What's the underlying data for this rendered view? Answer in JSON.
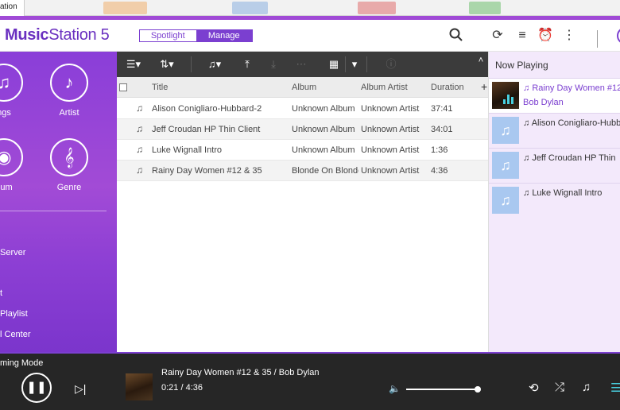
{
  "browser": {
    "tab_fragment": "ation"
  },
  "header": {
    "brand_bold": "Music",
    "brand_rest": "Station 5",
    "mode_spotlight": "Spotlight",
    "mode_manage": "Manage",
    "icons": [
      "search-icon",
      "refresh-icon",
      "sort-icon",
      "alarm-icon",
      "more-vertical-icon"
    ]
  },
  "sidebar": {
    "tiles": [
      {
        "label": "ngs",
        "icon": "music-note-icon",
        "glyph": "♫"
      },
      {
        "label": "Artist",
        "icon": "artist-icon",
        "glyph": "♪"
      },
      {
        "label": "bum",
        "icon": "album-disc-icon",
        "glyph": "◉"
      },
      {
        "label": "Genre",
        "icon": "guitar-icon",
        "glyph": "𝄞"
      }
    ],
    "items": [
      " Server",
      "t",
      " Playlist",
      "l Center"
    ]
  },
  "toolbar": {
    "icons": [
      "list-view-icon",
      "sort-order-icon",
      "add-to-playlist-icon",
      "move-to-top-icon",
      "download-icon",
      "share-icon",
      "grid-view-icon",
      "dropdown-icon",
      "info-icon"
    ]
  },
  "table": {
    "columns": {
      "title": "Title",
      "album": "Album",
      "album_artist": "Album Artist",
      "duration": "Duration"
    },
    "rows": [
      {
        "title": "Alison Conigliaro-Hubbard-2",
        "album": "Unknown Album",
        "album_artist": "Unknown Artist",
        "duration": "37:41"
      },
      {
        "title": "Jeff Croudan HP Thin Client",
        "album": "Unknown Album",
        "album_artist": "Unknown Artist",
        "duration": "34:01"
      },
      {
        "title": "Luke Wignall Intro",
        "album": "Unknown Album",
        "album_artist": "Unknown Artist",
        "duration": "1:36"
      },
      {
        "title": "Rainy Day Women #12 & 35",
        "album": "Blonde On Blonde",
        "album_artist": "Unknown Artist",
        "duration": "4:36"
      }
    ]
  },
  "now_playing": {
    "title": "Now Playing",
    "items": [
      {
        "name": "Rainy Day Women #12",
        "artist": "Bob Dylan",
        "active": true
      },
      {
        "name": "Alison Conigliaro-Hubb",
        "artist": "",
        "active": false
      },
      {
        "name": "Jeff Croudan HP Thin",
        "artist": "",
        "active": false
      },
      {
        "name": "Luke Wignall Intro",
        "artist": "",
        "active": false
      }
    ]
  },
  "player": {
    "mode_label": "ming Mode",
    "track": "Rainy Day Women #12 & 35 / Bob Dylan",
    "time": "0:21 / 4:36",
    "volume": 1.0,
    "colors": {
      "accent": "#7b3fd0",
      "bar": "#262626"
    }
  }
}
